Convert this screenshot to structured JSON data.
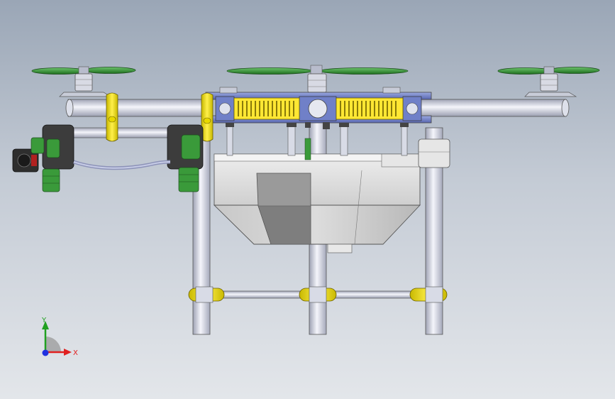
{
  "view": {
    "background_top": "#9aa6b6",
    "background_bottom": "#e3e6ea"
  },
  "model": {
    "frame_tube_color": "#e8eaf4",
    "clamp_color": "#ffec3c",
    "spray_tank_color": "#dcdcdc",
    "propeller_color": "#2e8b2e",
    "top_plate_color": "#6c7cc4",
    "nozzle_color": "#3a9a3a"
  },
  "triad": {
    "x_label": "X",
    "y_label": "Y",
    "x_color": "#e02020",
    "y_color": "#20a020",
    "z_color": "#2030e0"
  }
}
